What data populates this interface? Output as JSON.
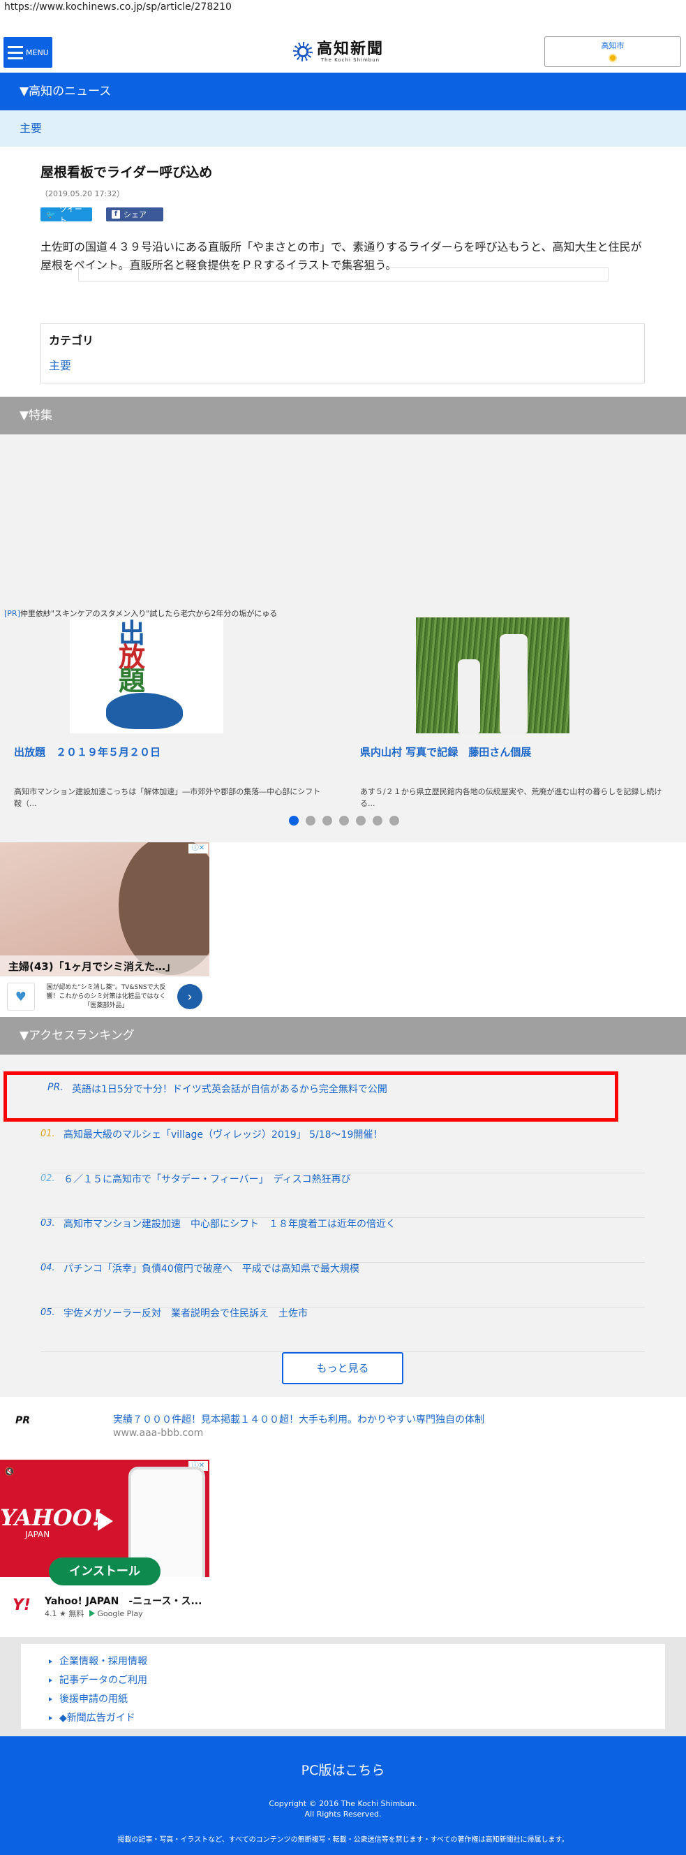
{
  "browser": {
    "url": "https://www.kochinews.co.jp/sp/article/278210"
  },
  "header": {
    "menu_label": "MENU",
    "logo_text": "高知新聞",
    "logo_sub": "The Kochi Shimbun",
    "weather_city": "高知市"
  },
  "section_news": "▼高知のニュース",
  "sub_category": "主要",
  "article": {
    "title": "屋根看板でライダー呼び込め",
    "date": "（2019.05.20 17:32）",
    "tweet": "ツイート",
    "share": "シェア",
    "body": "土佐町の国道４３９号沿いにある直販所「やまさとの市」で、素通りするライダーらを呼び込もうと、高知大生と住民が屋根をペイント。直販所名と軽食提供をＰＲするイラストで集客狙う。"
  },
  "category": {
    "title": "カテゴリ",
    "value": "主要"
  },
  "section_feature": "▼特集",
  "feature": {
    "pr_tag": "[PR]",
    "pr_text": "仲里依紗\"スキンケアのスタメン入り\"試したら老穴から2年分の垢がにゅる",
    "cards": [
      {
        "title": "出放題　２０１９年５月２０日",
        "desc": "高知市マンション建設加速こっちは「解体加速」―市郊外や郡部の集落―中心部にシフト鞍（...",
        "kanji": [
          "出",
          "放",
          "題"
        ]
      },
      {
        "title": "県内山村 写真で記録　藤田さん個展",
        "desc": "あす５/２１から県立歴民館内各地の伝統屋実や、荒廃が進む山村の暮らしを記録し続ける..."
      }
    ],
    "dots": 7,
    "active_dot": 0
  },
  "ad1": {
    "caption": "主婦(43)「1ヶ月でシミ消えた…」",
    "text": "国が認めた\"シミ消し薬\"。TV&SNSで大反響！これからのシミ対策は化粧品ではなく「医薬部外品」"
  },
  "section_ranking": "▼アクセスランキング",
  "ranking": {
    "pr": {
      "label": "PR.",
      "title": "英語は1日5分で十分！ドイツ式英会話が自信があるから完全無料で公開"
    },
    "items": [
      {
        "num": "01.",
        "title": "高知最大級のマルシェ「village（ヴィレッジ）2019」 5/18～19開催！",
        "color": "#e0a020"
      },
      {
        "num": "02.",
        "title": "６／１５に高知市で「サタデー・フィーバー」　ディスコ熱狂再び",
        "color": "#6ab0e0"
      },
      {
        "num": "03.",
        "title": "高知市マンション建設加速　中心部にシフト　１８年度着工は近年の倍近く",
        "color": "#1a66c8"
      },
      {
        "num": "04.",
        "title": "パチンコ「浜幸」負債40億円で破産へ　平成では高知県で最大規模",
        "color": "#1a66c8"
      },
      {
        "num": "05.",
        "title": "宇佐メガソーラー反対　業者説明会で住民訴え　土佐市",
        "color": "#1a66c8"
      }
    ],
    "more": "もっと見る"
  },
  "pr_ad": {
    "label": "PR",
    "title": "実績７０００件超！見本掲載１４００超！大手も利用。わかりやすい専門独自の体制",
    "url": "www.aaa-bbb.com"
  },
  "ad2": {
    "yahoo": "YAHOO!",
    "japan": "JAPAN",
    "install": "インストール",
    "app_name": "Yahoo! JAPAN　-ニュース・ス...",
    "rating": "4.1 ★  無料",
    "store": "Google Play"
  },
  "links": [
    "企業情報・採用情報",
    "記事データのご利用",
    "後援申請の用紙",
    "◆新聞広告ガイド"
  ],
  "footer": {
    "pc": "PC版はこちら",
    "copy1": "Copyright © 2016 The Kochi Shimbun.",
    "copy2": "All Rights Reserved.",
    "note": "掲載の記事・写真・イラストなど、すべてのコンテンツの無断複写・転載・公衆送信等を禁じます・すべての著作権は高知新聞社に帰属します。"
  },
  "colors": {
    "brand_blue": "#0b63e4",
    "link_blue": "#1a66c8",
    "highlight_red": "#ff0000"
  }
}
